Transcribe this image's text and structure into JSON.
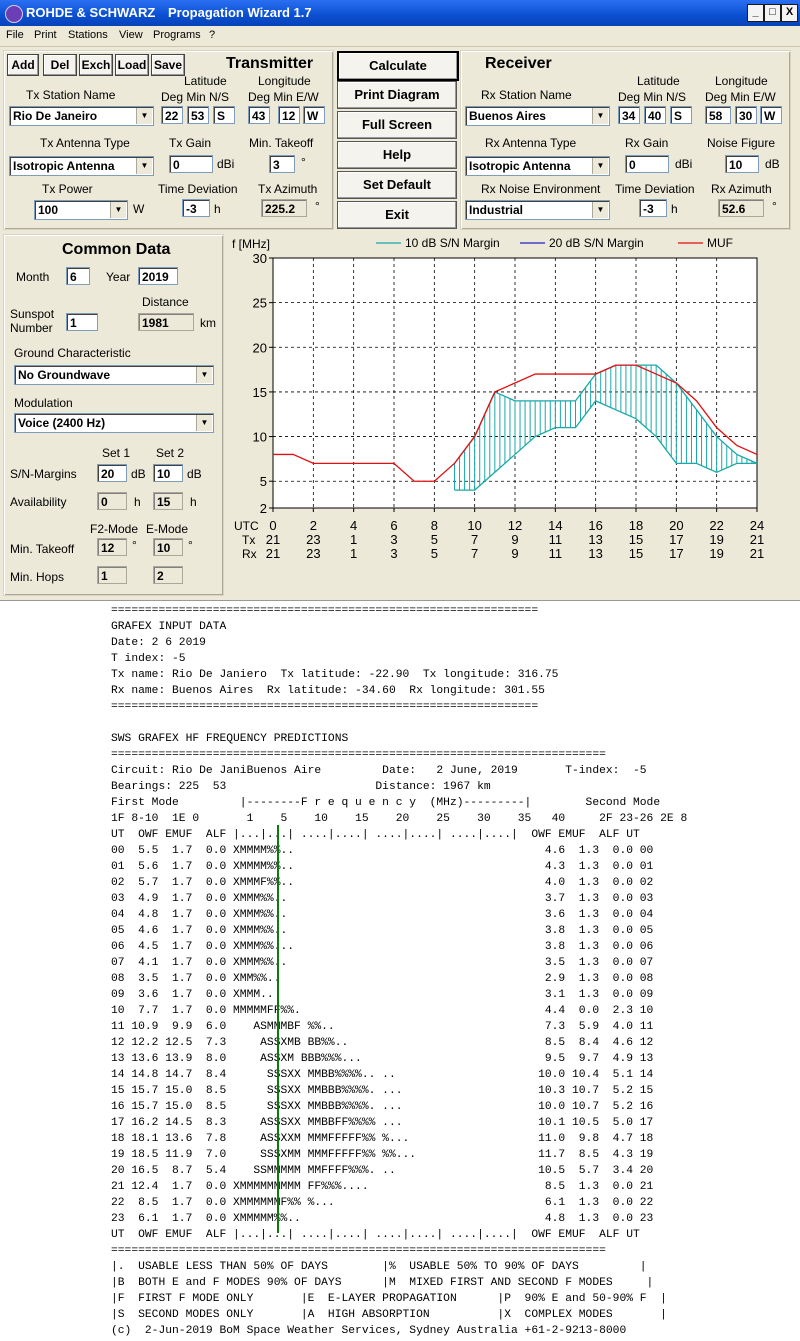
{
  "window": {
    "company": "ROHDE & SCHWARZ",
    "title": "Propagation Wizard  1.7",
    "min_glyph": "_",
    "max_glyph": "□",
    "close_glyph": "X"
  },
  "menu": [
    "File",
    "Print",
    "Stations",
    "View",
    "Programs",
    "?"
  ],
  "toolbar": [
    "Add",
    "Del",
    "Exch",
    "Load",
    "Save"
  ],
  "transmitter": {
    "heading": "Transmitter",
    "station_label": "Tx Station Name",
    "station": "Rio De Janeiro",
    "lat_label": "Latitude",
    "lon_label": "Longitude",
    "lat_sub": "Deg  Min  N/S",
    "lon_sub": "Deg   Min E/W",
    "lat_deg": "22",
    "lat_min": "53",
    "lat_ns": "S",
    "lon_deg": "43",
    "lon_min": "12",
    "lon_ew": "W",
    "antenna_label": "Tx Antenna Type",
    "antenna": "Isotropic Antenna",
    "gain_label": "Tx Gain",
    "gain": "0",
    "gain_unit": "dBi",
    "takeoff_label": "Min. Takeoff",
    "takeoff": "3",
    "deg_unit": "°",
    "power_label": "Tx Power",
    "power": "100",
    "power_unit": "W",
    "timedev_label": "Time Deviation",
    "timedev": "-3",
    "h_unit": "h",
    "azimuth_label": "Tx Azimuth",
    "azimuth": "225.2"
  },
  "receiver": {
    "heading": "Receiver",
    "station_label": "Rx Station Name",
    "station": "Buenos Aires",
    "lat_deg": "34",
    "lat_min": "40",
    "lat_ns": "S",
    "lon_deg": "58",
    "lon_min": "30",
    "lon_ew": "W",
    "antenna_label": "Rx Antenna Type",
    "antenna": "Isotropic Antenna",
    "gain_label": "Rx Gain",
    "gain": "0",
    "noise_label": "Noise Figure",
    "noise": "10",
    "noise_unit": "dB",
    "env_label": "Rx Noise Environment",
    "env": "Industrial",
    "timedev_label": "Time Deviation",
    "timedev": "-3",
    "azimuth_label": "Rx Azimuth",
    "azimuth": "52.6"
  },
  "actions": [
    "Calculate",
    "Print Diagram",
    "Full Screen",
    "Help",
    "Set Default",
    "Exit"
  ],
  "common": {
    "heading": "Common Data",
    "month_label": "Month",
    "month": "6",
    "year_label": "Year",
    "year": "2019",
    "distance_label": "Distance",
    "sunspot_label1": "Sunspot",
    "sunspot_label2": "Number",
    "sunspot": "1",
    "distance": "1981",
    "km": "km",
    "ground_label": "Ground Characteristic",
    "ground": "No Groundwave",
    "mod_label": "Modulation",
    "modulation": "Voice   (2400 Hz)",
    "set1": "Set 1",
    "set2": "Set 2",
    "snm_label": "S/N-Margins",
    "snm1": "20",
    "snm2": "10",
    "db": "dB",
    "avail_label": "Availability",
    "avail1": "0",
    "avail2": "15",
    "f2_label": "F2-Mode",
    "e_label": "E-Mode",
    "takeoff_label": "Min. Takeoff",
    "takeoff_f2": "12",
    "takeoff_e": "10",
    "hops_label": "Min. Hops",
    "hops_f2": "1",
    "hops_e": "2"
  },
  "chart_data": {
    "type": "line",
    "ylabel": "f [MHz]",
    "ylim": [
      2,
      30
    ],
    "yticks": [
      2,
      5,
      10,
      15,
      20,
      25,
      30
    ],
    "xlim": [
      0,
      24
    ],
    "x_row_labels": [
      "UTC",
      "Tx",
      "Rx"
    ],
    "utc_ticks": [
      "0",
      "2",
      "4",
      "6",
      "8",
      "10",
      "12",
      "14",
      "16",
      "18",
      "20",
      "22",
      "24"
    ],
    "tx_ticks": [
      "21",
      "23",
      "1",
      "3",
      "5",
      "7",
      "9",
      "11",
      "13",
      "15",
      "17",
      "19",
      "21"
    ],
    "rx_ticks": [
      "21",
      "23",
      "1",
      "3",
      "5",
      "7",
      "9",
      "11",
      "13",
      "15",
      "17",
      "19",
      "21"
    ],
    "grid": true,
    "legend_position": "top",
    "colors": {
      "snm10": "#1aa8a8",
      "snm20": "#2020c0",
      "muf": "#e01010"
    },
    "series": [
      {
        "name": "10 dB S/N Margin",
        "x": [
          9,
          10,
          11,
          12,
          13,
          14,
          15,
          16,
          17,
          18,
          19,
          20,
          21,
          22,
          23,
          24
        ],
        "upper": [
          7,
          10,
          15,
          14,
          14,
          14,
          14,
          17,
          18,
          18,
          18,
          16,
          13,
          10,
          8,
          7
        ],
        "lower": [
          4,
          4,
          6,
          8,
          10,
          11,
          11,
          14,
          13,
          12,
          10,
          7,
          7,
          6,
          7,
          7
        ]
      },
      {
        "name": "20 dB S/N Margin",
        "x": [],
        "upper": [],
        "lower": []
      },
      {
        "name": "MUF",
        "x": [
          0,
          1,
          2,
          3,
          4,
          5,
          6,
          7,
          8,
          9,
          10,
          11,
          12,
          13,
          14,
          15,
          16,
          17,
          18,
          19,
          20,
          21,
          22,
          23,
          24
        ],
        "y": [
          8,
          8,
          7,
          7,
          7,
          7,
          7,
          5,
          5,
          7,
          10,
          15,
          16,
          17,
          17,
          17,
          17,
          18,
          18,
          17,
          16,
          14,
          11,
          9,
          8
        ]
      }
    ]
  },
  "report": {
    "lines": [
      "===============================================================",
      "GRAFEX INPUT DATA",
      "Date: 2 6 2019",
      "T index: -5",
      "Tx name: Rio De Janiero  Tx latitude: -22.90  Tx longitude: 316.75",
      "Rx name: Buenos Aires  Rx latitude: -34.60  Rx longitude: 301.55",
      "===============================================================",
      "",
      "SWS GRAFEX HF FREQUENCY PREDICTIONS",
      "=========================================================================",
      "Circuit: Rio De JaniBuenos Aire         Date:   2 June, 2019       T-index:  -5",
      "Bearings: 225  53                      Distance: 1967 km",
      "First Mode         |--------F r e q u e n c y  (MHz)---------|        Second Mode",
      "1F 8-10  1E 0       1    5    10    15    20    25    30    35   40     2F 23-26 2E 8",
      "UT  OWF EMUF  ALF |...|...| ....|....| ....|....| ....|....|  OWF EMUF  ALF UT",
      "00  5.5  1.7  0.0 XMMMM%%..                                     4.6  1.3  0.0 00",
      "01  5.6  1.7  0.0 XMMMM%%..                                     4.3  1.3  0.0 01",
      "02  5.7  1.7  0.0 XMMMF%%..                                     4.0  1.3  0.0 02",
      "03  4.9  1.7  0.0 XMMM%%..                                      3.7  1.3  0.0 03",
      "04  4.8  1.7  0.0 XMMM%%..                                      3.6  1.3  0.0 04",
      "05  4.6  1.7  0.0 XMMM%%..                                      3.8  1.3  0.0 05",
      "06  4.5  1.7  0.0 XMMM%%...                                     3.8  1.3  0.0 06",
      "07  4.1  1.7  0.0 XMMM%%..                                      3.5  1.3  0.0 07",
      "08  3.5  1.7  0.0 XMM%%..                                       2.9  1.3  0.0 08",
      "09  3.6  1.7  0.0 XMMM..                                        3.1  1.3  0.0 09",
      "10  7.7  1.7  0.0 MMMMMFF%%.                                    4.4  0.0  2.3 10",
      "11 10.9  9.9  6.0    ASMMMBF %%..                               7.3  5.9  4.0 11",
      "12 12.2 12.5  7.3     ASSXMB BB%%..                             8.5  8.4  4.6 12",
      "13 13.6 13.9  8.0     ASSXM BBB%%%...                           9.5  9.7  4.9 13",
      "14 14.8 14.7  8.4      SSSXX MMBB%%%%.. ..                     10.0 10.4  5.1 14",
      "15 15.7 15.0  8.5      SSSXX MMBBB%%%%. ...                    10.3 10.7  5.2 15",
      "16 15.7 15.0  8.5      SSSXX MMBBB%%%%. ...                    10.0 10.7  5.2 16",
      "17 16.2 14.5  8.3     ASSSXX MMBBFF%%%% ...                    10.1 10.5  5.0 17",
      "18 18.1 13.6  7.8     ASSXXM MMMFFFFF%% %...                   11.0  9.8  4.7 18",
      "19 18.5 11.9  7.0     SSSXMM MMMFFFFF%% %%...                  11.7  8.5  4.3 19",
      "20 16.5  8.7  5.4    SSMMMMM MMFFFF%%%. ..                     10.5  5.7  3.4 20",
      "21 12.4  1.7  0.0 XMMMMMMMMM FF%%%....                          8.5  1.3  0.0 21",
      "22  8.5  1.7  0.0 XMMMMMMF%% %...                               6.1  1.3  0.0 22",
      "23  6.1  1.7  0.0 XMMMMM%%..                                    4.8  1.3  0.0 23",
      "UT  OWF EMUF  ALF |...|...| ....|....| ....|....| ....|....|  OWF EMUF  ALF UT",
      "=========================================================================",
      "|.  USABLE LESS THAN 50% OF DAYS        |%  USABLE 50% TO 90% OF DAYS         |",
      "|B  BOTH E and F MODES 90% OF DAYS      |M  MIXED FIRST AND SECOND F MODES     |",
      "|F  FIRST F MODE ONLY       |E  E-LAYER PROPAGATION      |P  90% E and 50-90% F  |",
      "|S  SECOND MODES ONLY       |A  HIGH ABSORPTION          |X  COMPLEX MODES       |",
      "(c)  2-Jun-2019 BoM Space Weather Services, Sydney Australia +61-2-9213-8000"
    ],
    "marker_color": "#0a7a0a"
  }
}
